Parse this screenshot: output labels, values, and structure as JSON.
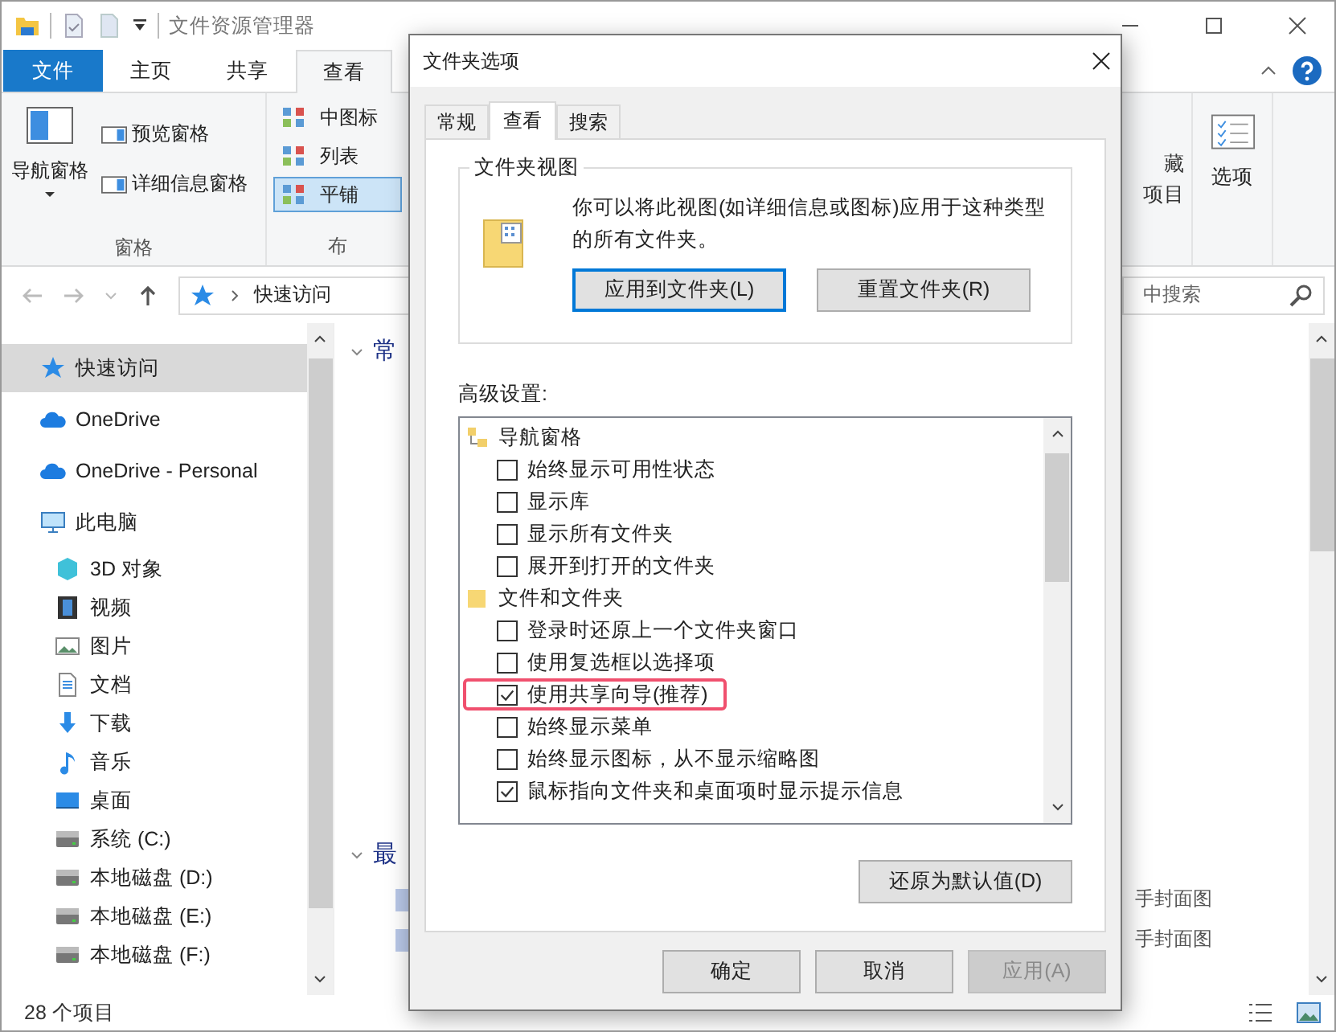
{
  "window": {
    "title": "文件资源管理器"
  },
  "ribbon_tabs": [
    {
      "label": "文件",
      "kind": "file",
      "selected": false
    },
    {
      "label": "主页",
      "kind": "tab",
      "selected": false
    },
    {
      "label": "共享",
      "kind": "tab",
      "selected": false
    },
    {
      "label": "查看",
      "kind": "tab",
      "selected": true
    }
  ],
  "ribbon": {
    "panes_group": {
      "label": "窗格",
      "nav_pane": "导航窗格",
      "items": [
        "预览窗格",
        "详细信息窗格"
      ]
    },
    "layout_group": {
      "label": "布",
      "items": [
        {
          "label": "中图标",
          "selected": false
        },
        {
          "label": "列表",
          "selected": false
        },
        {
          "label": "平铺",
          "selected": true
        }
      ]
    },
    "hidden_items": [
      "藏",
      "项目"
    ],
    "options": "选项"
  },
  "address_bar": {
    "path": "快速访问",
    "search_placeholder": "中搜索"
  },
  "sidebar": {
    "items": [
      {
        "label": "快速访问",
        "kind": "star",
        "selected": true
      },
      {
        "label": "OneDrive",
        "kind": "cloud",
        "selected": false
      },
      {
        "label": "OneDrive - Personal",
        "kind": "cloud",
        "selected": false
      },
      {
        "label": "此电脑",
        "kind": "pc",
        "selected": false,
        "children": [
          {
            "label": "3D 对象",
            "kind": "cube",
            "selected": false
          },
          {
            "label": "视频",
            "kind": "film",
            "selected": false
          },
          {
            "label": "图片",
            "kind": "picture",
            "selected": false
          },
          {
            "label": "文档",
            "kind": "document",
            "selected": false
          },
          {
            "label": "下载",
            "kind": "download",
            "selected": false
          },
          {
            "label": "音乐",
            "kind": "music",
            "selected": false
          },
          {
            "label": "桌面",
            "kind": "desktop",
            "selected": false
          },
          {
            "label": "系统 (C:)",
            "kind": "drive",
            "selected": false
          },
          {
            "label": "本地磁盘 (D:)",
            "kind": "drive",
            "selected": false
          },
          {
            "label": "本地磁盘 (E:)",
            "kind": "drive",
            "selected": false
          },
          {
            "label": "本地磁盘 (F:)",
            "kind": "drive",
            "selected": false
          }
        ]
      }
    ]
  },
  "content": {
    "sections": [
      {
        "title": "常"
      },
      {
        "title": "最"
      }
    ],
    "recent_files": [
      "手封面图",
      "手封面图"
    ]
  },
  "status_bar": {
    "count": "28 个项目"
  },
  "dialog": {
    "title": "文件夹选项",
    "tabs": [
      {
        "label": "常规",
        "selected": false
      },
      {
        "label": "查看",
        "selected": true
      },
      {
        "label": "搜索",
        "selected": false
      }
    ],
    "folder_views": {
      "legend": "文件夹视图",
      "description": "你可以将此视图(如详细信息或图标)应用于这种类型的所有文件夹。",
      "buttons": [
        {
          "label": "应用到文件夹(L)",
          "default": true
        },
        {
          "label": "重置文件夹(R)",
          "default": false
        }
      ]
    },
    "advanced_label": "高级设置:",
    "advanced": [
      {
        "label": "导航窗格",
        "kind": "nav",
        "children": [
          {
            "label": "始终显示可用性状态",
            "checked": false,
            "highlighted": false
          },
          {
            "label": "显示库",
            "checked": false,
            "highlighted": false
          },
          {
            "label": "显示所有文件夹",
            "checked": false,
            "highlighted": false
          },
          {
            "label": "展开到打开的文件夹",
            "checked": false,
            "highlighted": false
          }
        ]
      },
      {
        "label": "文件和文件夹",
        "kind": "folder",
        "children": [
          {
            "label": "登录时还原上一个文件夹窗口",
            "checked": false,
            "highlighted": false
          },
          {
            "label": "使用复选框以选择项",
            "checked": false,
            "highlighted": false
          },
          {
            "label": "使用共享向导(推荐)",
            "checked": true,
            "highlighted": true
          },
          {
            "label": "始终显示菜单",
            "checked": false,
            "highlighted": false
          },
          {
            "label": "始终显示图标，从不显示缩略图",
            "checked": false,
            "highlighted": false
          },
          {
            "label": "鼠标指向文件夹和桌面项时显示提示信息",
            "checked": true,
            "highlighted": false
          }
        ]
      }
    ],
    "restore_button": "还原为默认值(D)",
    "buttons": [
      {
        "label": "确定",
        "disabled": false
      },
      {
        "label": "取消",
        "disabled": false
      },
      {
        "label": "应用(A)",
        "disabled": true
      }
    ]
  }
}
